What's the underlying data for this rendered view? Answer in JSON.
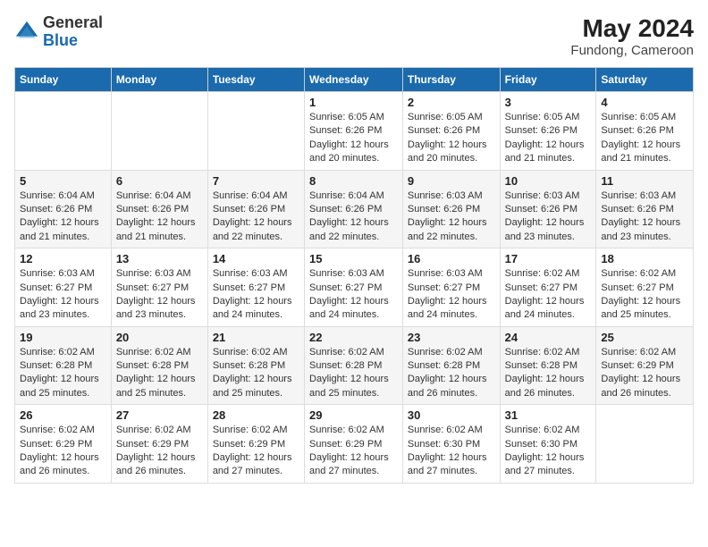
{
  "header": {
    "logo_general": "General",
    "logo_blue": "Blue",
    "month_year": "May 2024",
    "location": "Fundong, Cameroon"
  },
  "weekdays": [
    "Sunday",
    "Monday",
    "Tuesday",
    "Wednesday",
    "Thursday",
    "Friday",
    "Saturday"
  ],
  "weeks": [
    [
      {
        "day": "",
        "info": ""
      },
      {
        "day": "",
        "info": ""
      },
      {
        "day": "",
        "info": ""
      },
      {
        "day": "1",
        "info": "Sunrise: 6:05 AM\nSunset: 6:26 PM\nDaylight: 12 hours and 20 minutes."
      },
      {
        "day": "2",
        "info": "Sunrise: 6:05 AM\nSunset: 6:26 PM\nDaylight: 12 hours and 20 minutes."
      },
      {
        "day": "3",
        "info": "Sunrise: 6:05 AM\nSunset: 6:26 PM\nDaylight: 12 hours and 21 minutes."
      },
      {
        "day": "4",
        "info": "Sunrise: 6:05 AM\nSunset: 6:26 PM\nDaylight: 12 hours and 21 minutes."
      }
    ],
    [
      {
        "day": "5",
        "info": "Sunrise: 6:04 AM\nSunset: 6:26 PM\nDaylight: 12 hours and 21 minutes."
      },
      {
        "day": "6",
        "info": "Sunrise: 6:04 AM\nSunset: 6:26 PM\nDaylight: 12 hours and 21 minutes."
      },
      {
        "day": "7",
        "info": "Sunrise: 6:04 AM\nSunset: 6:26 PM\nDaylight: 12 hours and 22 minutes."
      },
      {
        "day": "8",
        "info": "Sunrise: 6:04 AM\nSunset: 6:26 PM\nDaylight: 12 hours and 22 minutes."
      },
      {
        "day": "9",
        "info": "Sunrise: 6:03 AM\nSunset: 6:26 PM\nDaylight: 12 hours and 22 minutes."
      },
      {
        "day": "10",
        "info": "Sunrise: 6:03 AM\nSunset: 6:26 PM\nDaylight: 12 hours and 23 minutes."
      },
      {
        "day": "11",
        "info": "Sunrise: 6:03 AM\nSunset: 6:26 PM\nDaylight: 12 hours and 23 minutes."
      }
    ],
    [
      {
        "day": "12",
        "info": "Sunrise: 6:03 AM\nSunset: 6:27 PM\nDaylight: 12 hours and 23 minutes."
      },
      {
        "day": "13",
        "info": "Sunrise: 6:03 AM\nSunset: 6:27 PM\nDaylight: 12 hours and 23 minutes."
      },
      {
        "day": "14",
        "info": "Sunrise: 6:03 AM\nSunset: 6:27 PM\nDaylight: 12 hours and 24 minutes."
      },
      {
        "day": "15",
        "info": "Sunrise: 6:03 AM\nSunset: 6:27 PM\nDaylight: 12 hours and 24 minutes."
      },
      {
        "day": "16",
        "info": "Sunrise: 6:03 AM\nSunset: 6:27 PM\nDaylight: 12 hours and 24 minutes."
      },
      {
        "day": "17",
        "info": "Sunrise: 6:02 AM\nSunset: 6:27 PM\nDaylight: 12 hours and 24 minutes."
      },
      {
        "day": "18",
        "info": "Sunrise: 6:02 AM\nSunset: 6:27 PM\nDaylight: 12 hours and 25 minutes."
      }
    ],
    [
      {
        "day": "19",
        "info": "Sunrise: 6:02 AM\nSunset: 6:28 PM\nDaylight: 12 hours and 25 minutes."
      },
      {
        "day": "20",
        "info": "Sunrise: 6:02 AM\nSunset: 6:28 PM\nDaylight: 12 hours and 25 minutes."
      },
      {
        "day": "21",
        "info": "Sunrise: 6:02 AM\nSunset: 6:28 PM\nDaylight: 12 hours and 25 minutes."
      },
      {
        "day": "22",
        "info": "Sunrise: 6:02 AM\nSunset: 6:28 PM\nDaylight: 12 hours and 25 minutes."
      },
      {
        "day": "23",
        "info": "Sunrise: 6:02 AM\nSunset: 6:28 PM\nDaylight: 12 hours and 26 minutes."
      },
      {
        "day": "24",
        "info": "Sunrise: 6:02 AM\nSunset: 6:28 PM\nDaylight: 12 hours and 26 minutes."
      },
      {
        "day": "25",
        "info": "Sunrise: 6:02 AM\nSunset: 6:29 PM\nDaylight: 12 hours and 26 minutes."
      }
    ],
    [
      {
        "day": "26",
        "info": "Sunrise: 6:02 AM\nSunset: 6:29 PM\nDaylight: 12 hours and 26 minutes."
      },
      {
        "day": "27",
        "info": "Sunrise: 6:02 AM\nSunset: 6:29 PM\nDaylight: 12 hours and 26 minutes."
      },
      {
        "day": "28",
        "info": "Sunrise: 6:02 AM\nSunset: 6:29 PM\nDaylight: 12 hours and 27 minutes."
      },
      {
        "day": "29",
        "info": "Sunrise: 6:02 AM\nSunset: 6:29 PM\nDaylight: 12 hours and 27 minutes."
      },
      {
        "day": "30",
        "info": "Sunrise: 6:02 AM\nSunset: 6:30 PM\nDaylight: 12 hours and 27 minutes."
      },
      {
        "day": "31",
        "info": "Sunrise: 6:02 AM\nSunset: 6:30 PM\nDaylight: 12 hours and 27 minutes."
      },
      {
        "day": "",
        "info": ""
      }
    ]
  ]
}
